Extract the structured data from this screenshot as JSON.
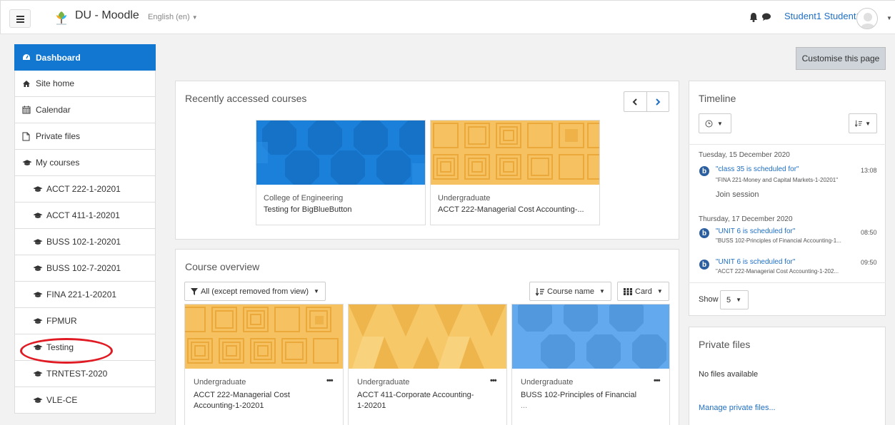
{
  "navbar": {
    "brand": "DU - Moodle",
    "language": "English (en)",
    "username": "Student1 Student1"
  },
  "sidebar": {
    "items": [
      {
        "label": "Dashboard",
        "icon": "dashboard-icon"
      },
      {
        "label": "Site home",
        "icon": "home-icon"
      },
      {
        "label": "Calendar",
        "icon": "calendar-icon"
      },
      {
        "label": "Private files",
        "icon": "file-icon"
      },
      {
        "label": "My courses",
        "icon": "graduation-cap-icon"
      },
      {
        "label": "ACCT 222-1-20201",
        "icon": "graduation-cap-icon"
      },
      {
        "label": "ACCT 411-1-20201",
        "icon": "graduation-cap-icon"
      },
      {
        "label": "BUSS 102-1-20201",
        "icon": "graduation-cap-icon"
      },
      {
        "label": "BUSS 102-7-20201",
        "icon": "graduation-cap-icon"
      },
      {
        "label": "FINA 221-1-20201",
        "icon": "graduation-cap-icon"
      },
      {
        "label": "FPMUR",
        "icon": "graduation-cap-icon"
      },
      {
        "label": "Testing",
        "icon": "graduation-cap-icon"
      },
      {
        "label": "TRNTEST-2020",
        "icon": "graduation-cap-icon"
      },
      {
        "label": "VLE-CE",
        "icon": "graduation-cap-icon"
      }
    ]
  },
  "main": {
    "customise_label": "Customise this page",
    "recent": {
      "title": "Recently accessed courses",
      "cards": [
        {
          "category": "College of Engineering",
          "name": "Testing for BigBlueButton"
        },
        {
          "category": "Undergraduate",
          "name": "ACCT 222-Managerial Cost Accounting-..."
        }
      ]
    },
    "overview": {
      "title": "Course overview",
      "filter_label": "All (except removed from view)",
      "sort_label": "Course name",
      "view_label": "Card",
      "cards": [
        {
          "category": "Undergraduate",
          "name1": "ACCT 222-Managerial Cost",
          "name2": "Accounting-1-20201"
        },
        {
          "category": "Undergraduate",
          "name1": "ACCT 411-Corporate Accounting-",
          "name2": "1-20201"
        },
        {
          "category": "Undergraduate",
          "name1": "BUSS 102-Principles of Financial",
          "name2": "..."
        }
      ]
    }
  },
  "timeline": {
    "title": "Timeline",
    "date1": "Tuesday, 15 December 2020",
    "event1": {
      "title": "\"class 35 is scheduled for\"",
      "course": "\"FINA 221-Money and Capital Markets-1-20201\"",
      "time": "13:08",
      "action": "Join session"
    },
    "date2": "Thursday, 17 December 2020",
    "event2": {
      "title": "\"UNIT 6 is scheduled for\"",
      "course": "\"BUSS 102-Principles of Financial Accounting-1...",
      "time": "08:50"
    },
    "event3": {
      "title": "\"UNIT 6 is scheduled for\"",
      "course": "\"ACCT 222-Managerial Cost Accounting-1-202...",
      "time": "09:50"
    },
    "show_label": "Show",
    "show_value": "5"
  },
  "private_files": {
    "title": "Private files",
    "empty": "No files available",
    "manage_link": "Manage private files..."
  },
  "colors": {
    "accent": "#1177d1",
    "annotation": "#e01b24"
  }
}
